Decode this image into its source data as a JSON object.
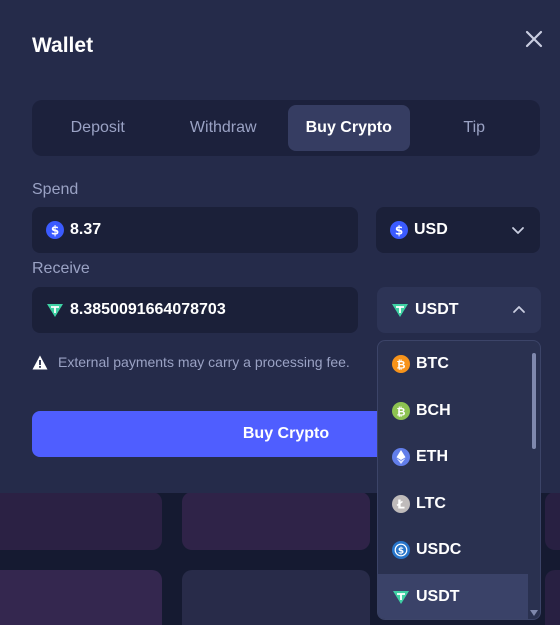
{
  "modal": {
    "title": "Wallet"
  },
  "tabs": [
    {
      "label": "Deposit"
    },
    {
      "label": "Withdraw"
    },
    {
      "label": "Buy Crypto"
    },
    {
      "label": "Tip"
    }
  ],
  "active_tab": "Buy Crypto",
  "spend": {
    "label": "Spend",
    "amount": "8.37",
    "currency": "USD"
  },
  "receive": {
    "label": "Receive",
    "amount": "8.3850091664078703",
    "currency": "USDT"
  },
  "notice": "External payments may carry a processing fee.",
  "buy_button": "Buy Crypto",
  "dropdown": {
    "options": [
      {
        "label": "BTC",
        "color": "#f7931a"
      },
      {
        "label": "BCH",
        "color": "#8dc351"
      },
      {
        "label": "ETH",
        "color": "#627eea"
      },
      {
        "label": "LTC",
        "color": "#bfbbbb"
      },
      {
        "label": "USDC",
        "color": "#2775ca"
      },
      {
        "label": "USDT",
        "color": "#26a17b"
      }
    ],
    "selected": "USDT"
  },
  "colors": {
    "accent": "#4f5eff",
    "usd_icon": "#3b5bff",
    "usdt_icon": "#3fd1a4"
  }
}
